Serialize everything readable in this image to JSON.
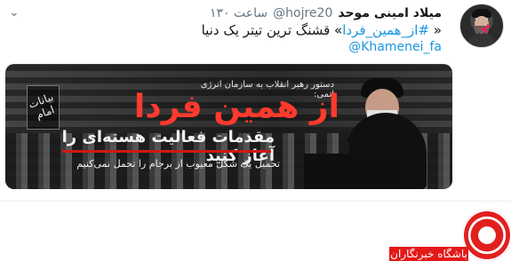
{
  "tweet": {
    "display_name": "میلاد امینی موحد",
    "username": "@hojre20",
    "timestamp": "۱۳۰ ساعت",
    "text_prefix": "« ",
    "hashtag": "#از_همین_فردا",
    "text_suffix": "» قشنگ ترین تیتر یک دنیا",
    "mention": "@Khamenei_fa",
    "caret": "⌄"
  },
  "media": {
    "top_line": "دستور رهبر انقلاب به سازمان انرژی اتمی:",
    "title": "از همین فردا",
    "subtitle": "مقدمات فعالیت هسته‌ای را آغاز کنید",
    "footer": "تحمیل یک شکل معیوب از برجام را تحمل نمی‌کنیم",
    "logo_text": "بیانات امام"
  },
  "watermark": {
    "label": "باشگاه خبرنگاران"
  },
  "icons": {
    "pin": "pushpin-icon"
  },
  "colors": {
    "link": "#1b95e0",
    "headline_red": "#ff3a2d",
    "watermark_red": "#e31919"
  }
}
